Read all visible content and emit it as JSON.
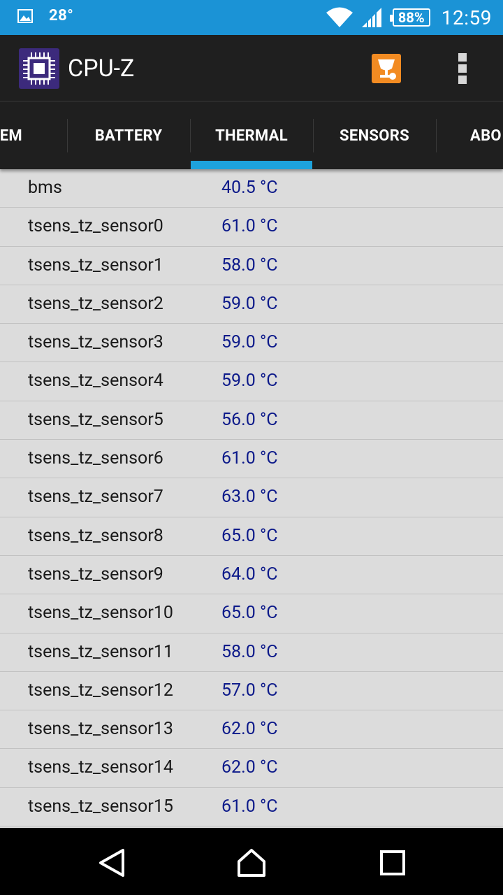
{
  "status_bar": {
    "temperature": "28°",
    "battery": "88%",
    "time": "12:59",
    "icons": [
      "image-icon",
      "wifi-icon",
      "signal-icon",
      "battery-icon"
    ]
  },
  "app_bar": {
    "title": "CPU-Z",
    "actions": [
      "trophy-icon",
      "overflow-menu-icon"
    ]
  },
  "tabs": [
    {
      "label": "STEM"
    },
    {
      "label": "BATTERY"
    },
    {
      "label": "THERMAL",
      "selected": true
    },
    {
      "label": "SENSORS"
    },
    {
      "label": "ABO"
    }
  ],
  "thermal_rows": [
    {
      "name": "bms",
      "value": "40.5 °C"
    },
    {
      "name": "tsens_tz_sensor0",
      "value": "61.0 °C"
    },
    {
      "name": "tsens_tz_sensor1",
      "value": "58.0 °C"
    },
    {
      "name": "tsens_tz_sensor2",
      "value": "59.0 °C"
    },
    {
      "name": "tsens_tz_sensor3",
      "value": "59.0 °C"
    },
    {
      "name": "tsens_tz_sensor4",
      "value": "59.0 °C"
    },
    {
      "name": "tsens_tz_sensor5",
      "value": "56.0 °C"
    },
    {
      "name": "tsens_tz_sensor6",
      "value": "61.0 °C"
    },
    {
      "name": "tsens_tz_sensor7",
      "value": "63.0 °C"
    },
    {
      "name": "tsens_tz_sensor8",
      "value": "65.0 °C"
    },
    {
      "name": "tsens_tz_sensor9",
      "value": "64.0 °C"
    },
    {
      "name": "tsens_tz_sensor10",
      "value": "65.0 °C"
    },
    {
      "name": "tsens_tz_sensor11",
      "value": "58.0 °C"
    },
    {
      "name": "tsens_tz_sensor12",
      "value": "57.0 °C"
    },
    {
      "name": "tsens_tz_sensor13",
      "value": "62.0 °C"
    },
    {
      "name": "tsens_tz_sensor14",
      "value": "62.0 °C"
    },
    {
      "name": "tsens_tz_sensor15",
      "value": "61.0 °C"
    }
  ],
  "nav_bar": {
    "buttons": [
      "back-icon",
      "home-icon",
      "recents-icon"
    ]
  },
  "colors": {
    "status_bar": "#1b93d6",
    "app_bar": "#1f1f1f",
    "tab_indicator": "#1da2dc",
    "list_bg": "#dcdcdc",
    "value_text": "#0d1a8a",
    "app_icon": "#3c2a7c",
    "trophy": "#f28b22"
  }
}
